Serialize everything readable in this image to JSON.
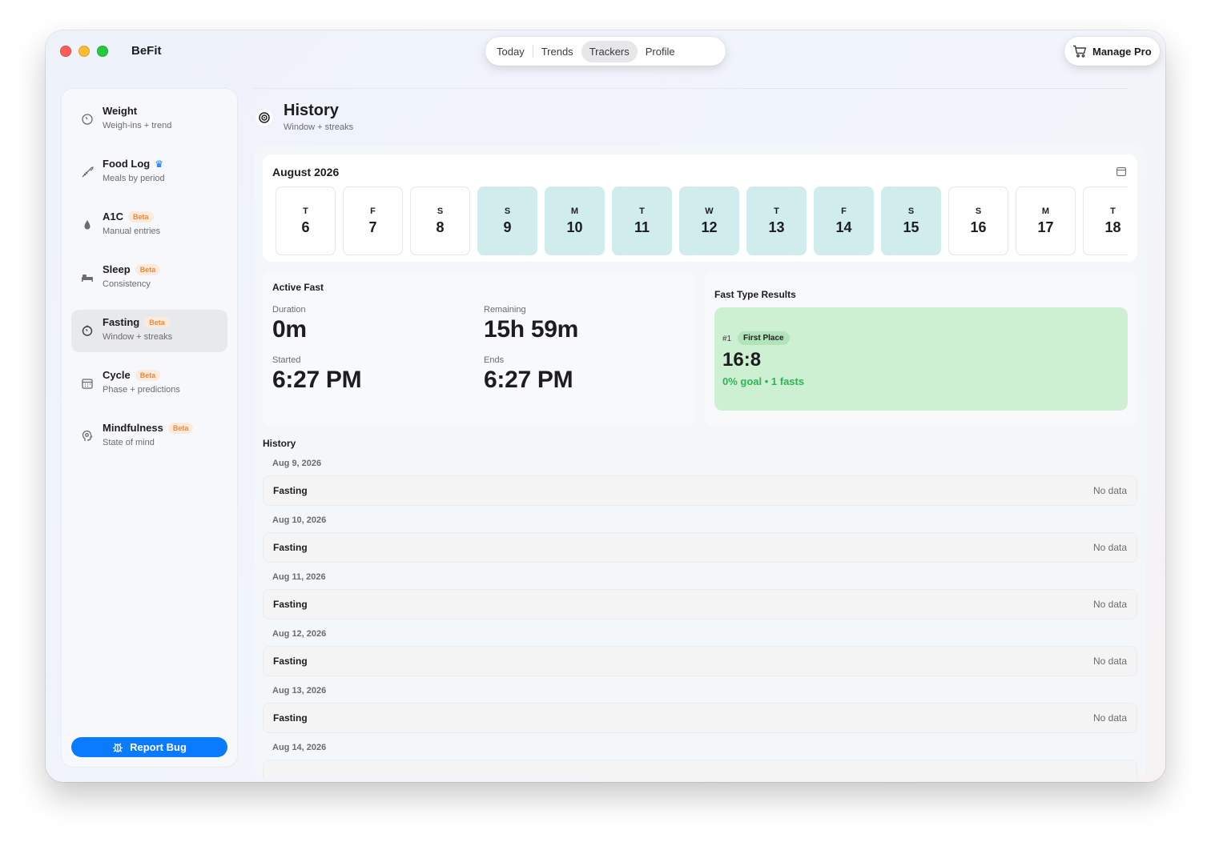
{
  "app": {
    "title": "BeFit"
  },
  "tabs": [
    {
      "label": "Today",
      "active": false
    },
    {
      "label": "Trends",
      "active": false
    },
    {
      "label": "Trackers",
      "active": true
    },
    {
      "label": "Profile",
      "active": false
    }
  ],
  "manage_pro": {
    "label": "Manage Pro",
    "icon": "cart-icon"
  },
  "sidebar": {
    "items": [
      {
        "title": "Weight",
        "subtitle": "Weigh-ins + trend",
        "icon": "scale-icon",
        "badge": "",
        "crown": false,
        "active": false
      },
      {
        "title": "Food Log",
        "subtitle": "Meals by period",
        "icon": "carrot-icon",
        "badge": "",
        "crown": true,
        "active": false
      },
      {
        "title": "A1C",
        "subtitle": "Manual entries",
        "icon": "drop-icon",
        "badge": "Beta",
        "crown": false,
        "active": false
      },
      {
        "title": "Sleep",
        "subtitle": "Consistency",
        "icon": "bed-icon",
        "badge": "Beta",
        "crown": false,
        "active": false
      },
      {
        "title": "Fasting",
        "subtitle": "Window + streaks",
        "icon": "timer-icon",
        "badge": "Beta",
        "crown": false,
        "active": true
      },
      {
        "title": "Cycle",
        "subtitle": "Phase + predictions",
        "icon": "calendar-icon",
        "badge": "Beta",
        "crown": false,
        "active": false
      },
      {
        "title": "Mindfulness",
        "subtitle": "State of mind",
        "icon": "head-icon",
        "badge": "Beta",
        "crown": false,
        "active": false
      }
    ],
    "report_bug": "Report Bug"
  },
  "page": {
    "title": "History",
    "subtitle": "Window + streaks",
    "icon": "target-icon"
  },
  "calendar": {
    "month": "August 2026",
    "days": [
      {
        "letter": "T",
        "num": "6",
        "highlight": false
      },
      {
        "letter": "F",
        "num": "7",
        "highlight": false
      },
      {
        "letter": "S",
        "num": "8",
        "highlight": false
      },
      {
        "letter": "S",
        "num": "9",
        "highlight": true
      },
      {
        "letter": "M",
        "num": "10",
        "highlight": true
      },
      {
        "letter": "T",
        "num": "11",
        "highlight": true
      },
      {
        "letter": "W",
        "num": "12",
        "highlight": true
      },
      {
        "letter": "T",
        "num": "13",
        "highlight": true
      },
      {
        "letter": "F",
        "num": "14",
        "highlight": true
      },
      {
        "letter": "S",
        "num": "15",
        "highlight": true
      },
      {
        "letter": "S",
        "num": "16",
        "highlight": false
      },
      {
        "letter": "M",
        "num": "17",
        "highlight": false
      },
      {
        "letter": "T",
        "num": "18",
        "highlight": false
      }
    ]
  },
  "active_fast": {
    "title": "Active Fast",
    "duration_label": "Duration",
    "duration": "0m",
    "remaining_label": "Remaining",
    "remaining": "15h 59m",
    "started_label": "Started",
    "started": "6:27 PM",
    "ends_label": "Ends",
    "ends": "6:27 PM"
  },
  "results": {
    "title": "Fast Type Results",
    "rank": "#1",
    "badge": "First Place",
    "type": "16:8",
    "meta": "0% goal • 1 fasts"
  },
  "history": {
    "title": "History",
    "entries": [
      {
        "date": "Aug 9, 2026",
        "label": "Fasting",
        "value": "No data"
      },
      {
        "date": "Aug 10, 2026",
        "label": "Fasting",
        "value": "No data"
      },
      {
        "date": "Aug 11, 2026",
        "label": "Fasting",
        "value": "No data"
      },
      {
        "date": "Aug 12, 2026",
        "label": "Fasting",
        "value": "No data"
      },
      {
        "date": "Aug 13, 2026",
        "label": "Fasting",
        "value": "No data"
      },
      {
        "date": "Aug 14, 2026",
        "label": "",
        "value": ""
      }
    ]
  },
  "colors": {
    "accent": "#0a7bff",
    "highlight_day": "#d0ecec",
    "result_bg": "#cdf0d3",
    "result_text": "#31b455",
    "beta_text": "#f0883a"
  }
}
